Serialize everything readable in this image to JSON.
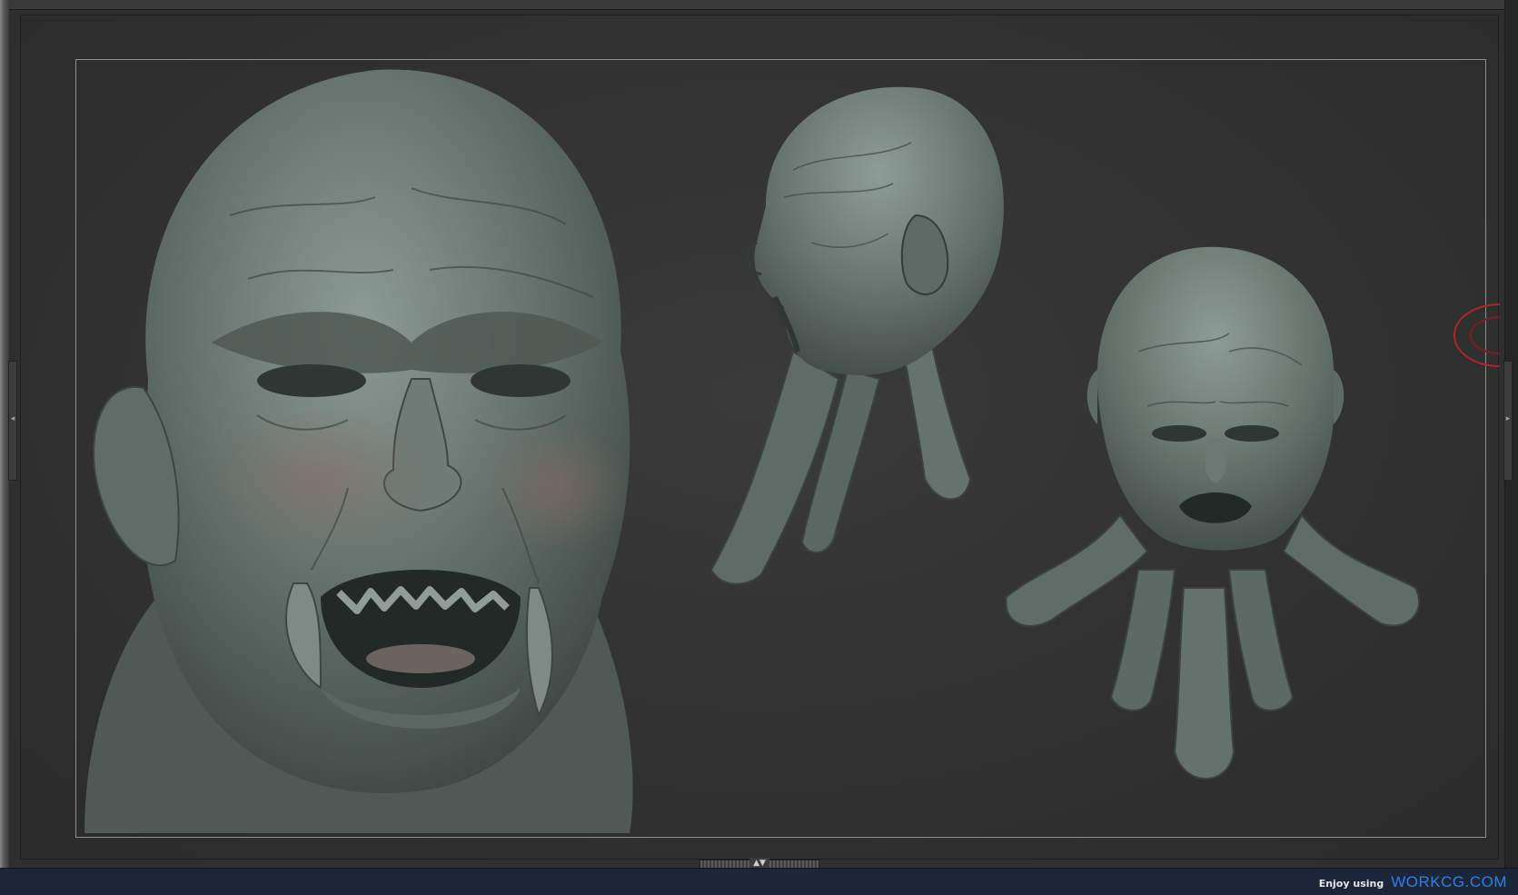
{
  "footer": {
    "tagline": "Enjoy using",
    "brand": "WORKCG.COM"
  },
  "colors": {
    "canvas_background": "#333333",
    "frame_line": "#8d8d8d",
    "sculpt_clay": "#5d6b66",
    "footer_background": "#1d2638",
    "footer_brand": "#2f7fe8",
    "gizmo_ring": "#b0242a"
  },
  "icons": {
    "left_handle": "left-handle-arrow-icon",
    "right_handle": "right-handle-arrow-icon",
    "bottom_handle": "bottom-handle-arrow-icon",
    "gizmo": "rotation-gizmo-icon"
  }
}
